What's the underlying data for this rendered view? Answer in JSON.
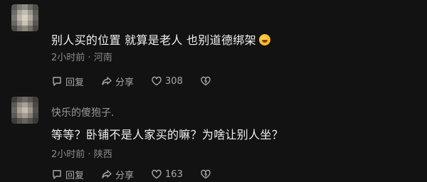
{
  "comments": [
    {
      "content": "别人买的位置 就算是老人 也别道德绑架",
      "emoji": "laughing-emoji",
      "time": "2小时前",
      "location": "河南",
      "reply_label": "回复",
      "share_label": "分享",
      "likes": "308"
    },
    {
      "username": "快乐的傻狍子.",
      "content": "等等？卧铺不是人家买的嘛？为啥让别人坐？",
      "time": "2小时前",
      "location": "陕西",
      "reply_label": "回复",
      "share_label": "分享",
      "likes": "163"
    }
  ],
  "separator": " · ",
  "colors": {
    "background": "#121212",
    "text": "#f0f0f0",
    "secondary": "#8a8a8a"
  },
  "icons": [
    "reply-icon",
    "share-icon",
    "heart-icon",
    "dislike-icon"
  ]
}
